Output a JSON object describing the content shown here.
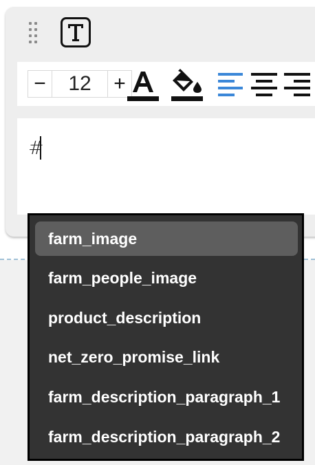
{
  "toolbar": {
    "font_size_decrement": "−",
    "font_size_value": "12",
    "font_size_increment": "+",
    "colors": {
      "text_color": "#111111",
      "fill_color": "#111111",
      "active_align": "#3b87d8"
    }
  },
  "icons": {
    "drag_handle": "drag-handle-icon",
    "text_type": "text-type-icon",
    "text_color": "text-color-icon",
    "fill_color": "fill-color-icon",
    "align_left": "align-left-icon",
    "align_center": "align-center-icon",
    "align_right": "align-right-icon"
  },
  "editor": {
    "text": "#"
  },
  "suggestions": {
    "items": [
      {
        "label": "farm_image",
        "selected": true
      },
      {
        "label": "farm_people_image",
        "selected": false
      },
      {
        "label": "product_description",
        "selected": false
      },
      {
        "label": "net_zero_promise_link",
        "selected": false
      },
      {
        "label": "farm_description_paragraph_1",
        "selected": false
      },
      {
        "label": "farm_description_paragraph_2",
        "selected": false
      }
    ]
  }
}
